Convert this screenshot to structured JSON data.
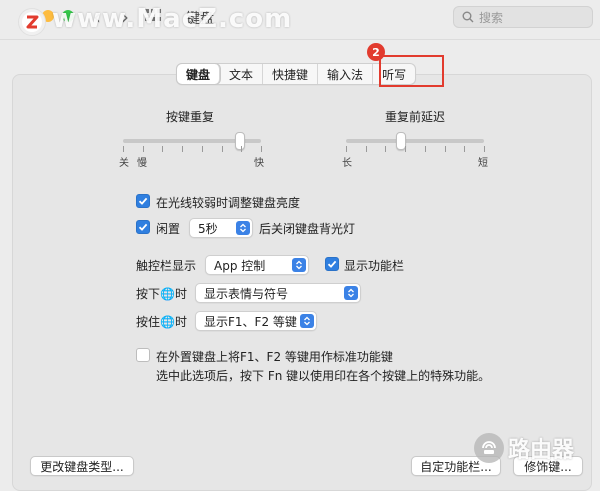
{
  "window": {
    "title": "键盘",
    "watermark": "www.MacZ.com",
    "search_placeholder": "搜索"
  },
  "tabs": [
    {
      "label": "键盘",
      "active": true
    },
    {
      "label": "文本",
      "active": false
    },
    {
      "label": "快捷键",
      "active": false
    },
    {
      "label": "输入法",
      "active": false
    },
    {
      "label": "听写",
      "active": false
    }
  ],
  "annotation": {
    "step": "2",
    "color": "#e23b2e"
  },
  "key_repeat": {
    "title": "按键重复",
    "min_label": "关",
    "slow_label": "慢",
    "max_label": "快",
    "value_fraction": 0.85
  },
  "delay_until_repeat": {
    "title": "重复前延迟",
    "min_label": "长",
    "max_label": "短",
    "value_fraction": 0.4
  },
  "options": {
    "adjust_brightness": {
      "label": "在光线较弱时调整键盘亮度",
      "checked": true
    },
    "idle_backlight": {
      "prefix": "闲置",
      "value": "5秒",
      "suffix": "后关闭键盘背光灯",
      "checked": true
    },
    "touchbar": {
      "label": "触控栏显示",
      "value": "App 控制"
    },
    "show_fn_strip": {
      "label": "显示功能栏",
      "checked": true
    },
    "press_globe": {
      "label": "按下🌐时",
      "value": "显示表情与符号"
    },
    "hold_globe": {
      "label": "按住🌐时",
      "value": "显示F1、F2 等键"
    },
    "fn_keys": {
      "label": "在外置键盘上将F1、F2 等键用作标准功能键",
      "note": "选中此选项后，按下 Fn 键以使用印在各个按键上的特殊功能。",
      "checked": false
    }
  },
  "buttons": {
    "change_type": "更改键盘类型...",
    "customize": "自定功能栏...",
    "modifier": "修饰键..."
  },
  "site_badge": "路由器",
  "colors": {
    "accent": "#2f7fe0",
    "background": "#ececec"
  }
}
